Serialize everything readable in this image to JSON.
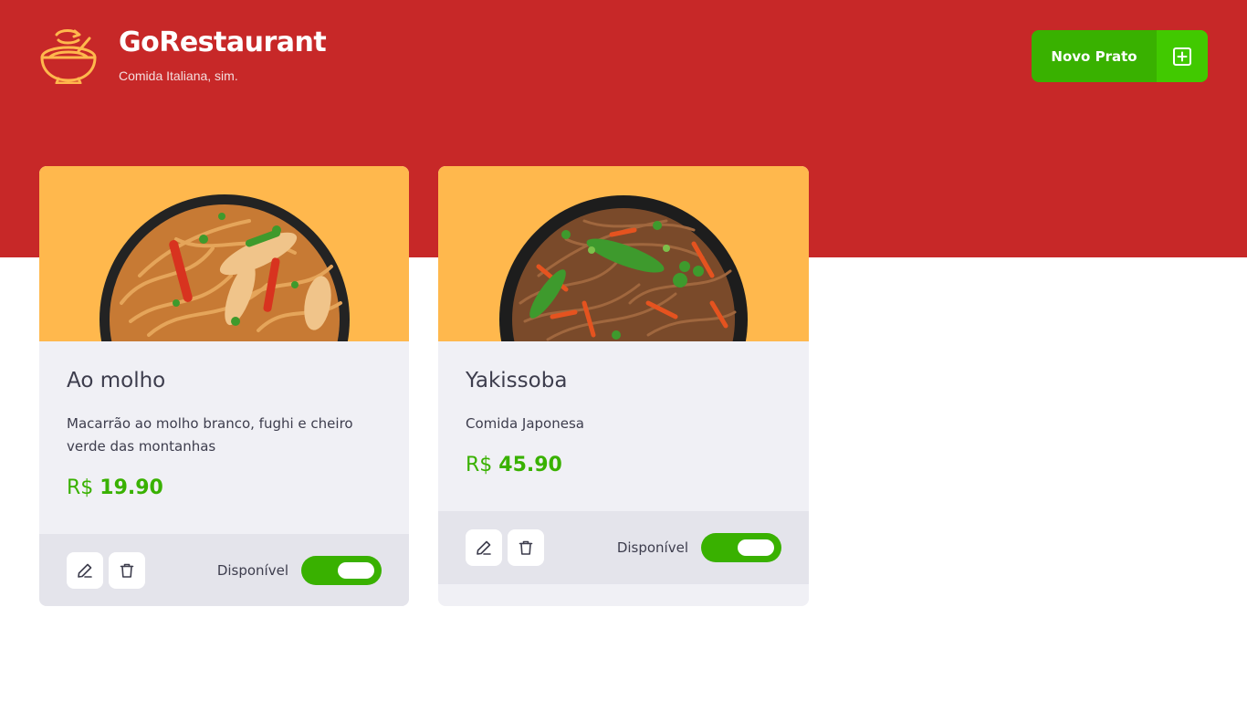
{
  "header": {
    "title": "GoRestaurant",
    "subtitle": "Comida Italiana, sim.",
    "new_button_label": "Novo Prato",
    "logo_icon": "food-bowl-icon",
    "add_icon": "plus-square-icon"
  },
  "colors": {
    "header_bg": "#c72828",
    "card_image_bg": "#ffb84d",
    "accent_green": "#39b100",
    "text_dark": "#3d3d4d"
  },
  "foods": [
    {
      "name": "Ao molho",
      "description": "Macarrão ao molho branco, fughi e cheiro verde das montanhas",
      "currency": "R$",
      "price": "19.90",
      "available_label": "Disponível",
      "available": true,
      "edit_icon": "pencil-icon",
      "delete_icon": "trash-icon"
    },
    {
      "name": "Yakissoba",
      "description": "Comida Japonesa",
      "currency": "R$",
      "price": "45.90",
      "available_label": "Disponível",
      "available": true,
      "edit_icon": "pencil-icon",
      "delete_icon": "trash-icon"
    }
  ]
}
